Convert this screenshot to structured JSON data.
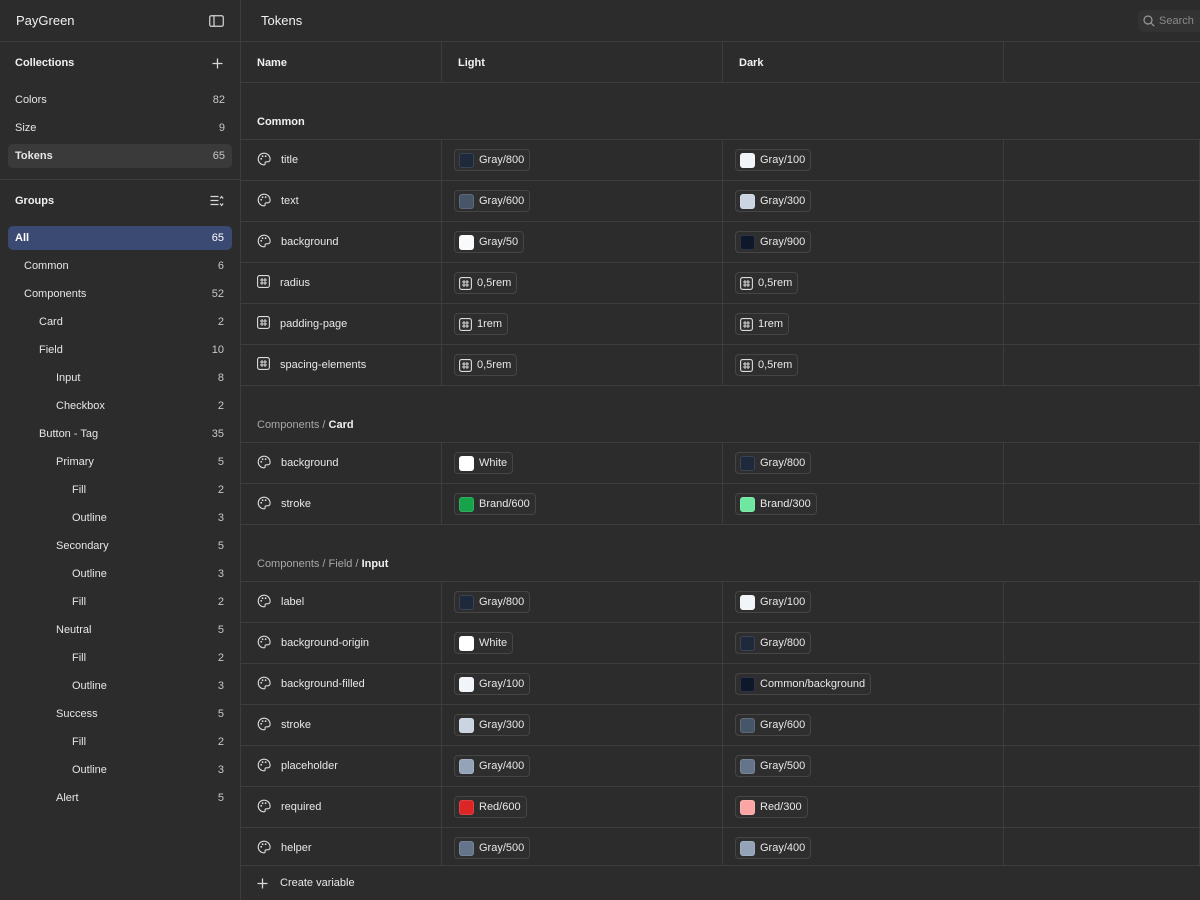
{
  "app": {
    "name": "PayGreen"
  },
  "collections": {
    "heading": "Collections",
    "items": [
      {
        "label": "Colors",
        "count": "82",
        "active": false
      },
      {
        "label": "Size",
        "count": "9",
        "active": false
      },
      {
        "label": "Tokens",
        "count": "65",
        "active": true
      }
    ]
  },
  "groups": {
    "heading": "Groups",
    "items": [
      {
        "label": "All",
        "count": "65",
        "level": 0,
        "active": true
      },
      {
        "label": "Common",
        "count": "6",
        "level": 1
      },
      {
        "label": "Components",
        "count": "52",
        "level": 1
      },
      {
        "label": "Card",
        "count": "2",
        "level": 2
      },
      {
        "label": "Field",
        "count": "10",
        "level": 2
      },
      {
        "label": "Input",
        "count": "8",
        "level": 3
      },
      {
        "label": "Checkbox",
        "count": "2",
        "level": 3
      },
      {
        "label": "Button - Tag",
        "count": "35",
        "level": 2
      },
      {
        "label": "Primary",
        "count": "5",
        "level": 3
      },
      {
        "label": "Fill",
        "count": "2",
        "level": 4
      },
      {
        "label": "Outline",
        "count": "3",
        "level": 4
      },
      {
        "label": "Secondary",
        "count": "5",
        "level": 3
      },
      {
        "label": "Outline",
        "count": "3",
        "level": 4
      },
      {
        "label": "Fill",
        "count": "2",
        "level": 4
      },
      {
        "label": "Neutral",
        "count": "5",
        "level": 3
      },
      {
        "label": "Fill",
        "count": "2",
        "level": 4
      },
      {
        "label": "Outline",
        "count": "3",
        "level": 4
      },
      {
        "label": "Success",
        "count": "5",
        "level": 3
      },
      {
        "label": "Fill",
        "count": "2",
        "level": 4
      },
      {
        "label": "Outline",
        "count": "3",
        "level": 4
      },
      {
        "label": "Alert",
        "count": "5",
        "level": 3
      }
    ]
  },
  "main": {
    "title": "Tokens",
    "search_placeholder": "Search",
    "columns": [
      "Name",
      "Light",
      "Dark"
    ],
    "create_label": "Create variable",
    "sections": [
      {
        "path": "",
        "leaf": "Common",
        "rows": [
          {
            "name": "title",
            "type": "color",
            "light": {
              "label": "Gray/800",
              "swatch": "#1e293b"
            },
            "dark": {
              "label": "Gray/100",
              "swatch": "#f1f5f9"
            }
          },
          {
            "name": "text",
            "type": "color",
            "light": {
              "label": "Gray/600",
              "swatch": "#475569"
            },
            "dark": {
              "label": "Gray/300",
              "swatch": "#cbd5e1"
            }
          },
          {
            "name": "background",
            "type": "color",
            "light": {
              "label": "Gray/50",
              "swatch": "#f8fafc"
            },
            "dark": {
              "label": "Gray/900",
              "swatch": "#0f172a"
            }
          },
          {
            "name": "radius",
            "type": "number",
            "light": {
              "label": "0,5rem"
            },
            "dark": {
              "label": "0,5rem"
            }
          },
          {
            "name": "padding-page",
            "type": "number",
            "light": {
              "label": "1rem"
            },
            "dark": {
              "label": "1rem"
            }
          },
          {
            "name": "spacing-elements",
            "type": "number",
            "light": {
              "label": "0,5rem"
            },
            "dark": {
              "label": "0,5rem"
            }
          }
        ]
      },
      {
        "path": "Components / ",
        "leaf": "Card",
        "rows": [
          {
            "name": "background",
            "type": "color",
            "light": {
              "label": "White",
              "swatch": "#ffffff"
            },
            "dark": {
              "label": "Gray/800",
              "swatch": "#1e293b"
            }
          },
          {
            "name": "stroke",
            "type": "color",
            "light": {
              "label": "Brand/600",
              "swatch": "#16a34a"
            },
            "dark": {
              "label": "Brand/300",
              "swatch": "#6ee7a0"
            }
          }
        ]
      },
      {
        "path": "Components / Field / ",
        "leaf": "Input",
        "rows": [
          {
            "name": "label",
            "type": "color",
            "light": {
              "label": "Gray/800",
              "swatch": "#1e293b"
            },
            "dark": {
              "label": "Gray/100",
              "swatch": "#f1f5f9"
            }
          },
          {
            "name": "background-origin",
            "type": "color",
            "light": {
              "label": "White",
              "swatch": "#ffffff"
            },
            "dark": {
              "label": "Gray/800",
              "swatch": "#1e293b"
            }
          },
          {
            "name": "background-filled",
            "type": "color",
            "light": {
              "label": "Gray/100",
              "swatch": "#f1f5f9"
            },
            "dark": {
              "label": "Common/background",
              "swatch": "#0f172a"
            }
          },
          {
            "name": "stroke",
            "type": "color",
            "light": {
              "label": "Gray/300",
              "swatch": "#cbd5e1"
            },
            "dark": {
              "label": "Gray/600",
              "swatch": "#475569"
            }
          },
          {
            "name": "placeholder",
            "type": "color",
            "light": {
              "label": "Gray/400",
              "swatch": "#94a3b8"
            },
            "dark": {
              "label": "Gray/500",
              "swatch": "#64748b"
            }
          },
          {
            "name": "required",
            "type": "color",
            "light": {
              "label": "Red/600",
              "swatch": "#dc2626"
            },
            "dark": {
              "label": "Red/300",
              "swatch": "#fca5a5"
            }
          },
          {
            "name": "helper",
            "type": "color",
            "light": {
              "label": "Gray/500",
              "swatch": "#64748b"
            },
            "dark": {
              "label": "Gray/400",
              "swatch": "#94a3b8"
            }
          }
        ]
      }
    ]
  }
}
